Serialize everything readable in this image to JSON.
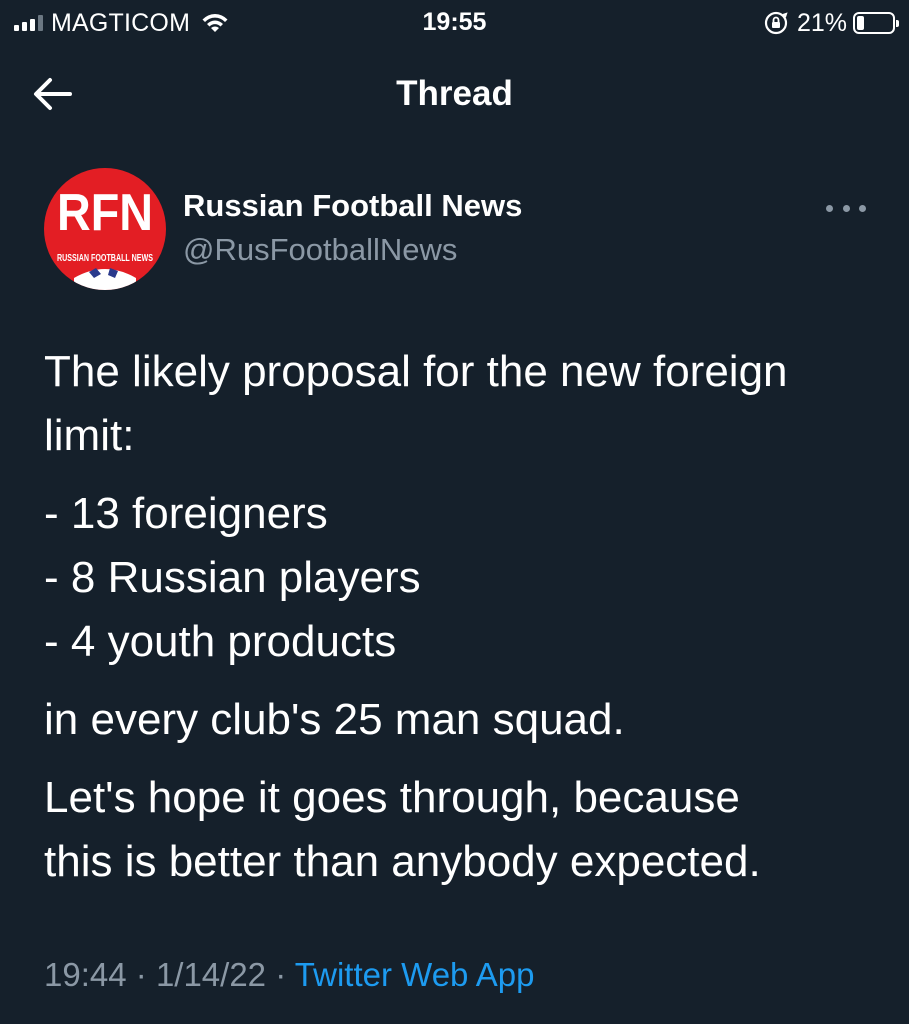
{
  "status_bar": {
    "carrier": "MAGTICOM",
    "time": "19:55",
    "battery_percent": "21%",
    "battery_level": 0.21,
    "signal_bars_active": 3,
    "signal_bars_total": 4
  },
  "nav": {
    "title": "Thread",
    "back_icon": "arrow-left-icon"
  },
  "tweet": {
    "author": {
      "name": "Russian Football News",
      "handle": "@RusFootballNews",
      "avatar_text": "RFN",
      "avatar_subtext": "RUSSIAN FOOTBALL NEWS"
    },
    "text": {
      "intro_line1": "The likely proposal for the new foreign",
      "intro_line2": "limit:",
      "item1": "- 13 foreigners",
      "item2": "- 8 Russian players",
      "item3": "- 4 youth products",
      "squad_line": "in every club's 25 man squad.",
      "closing_line1": "Let's hope it goes through, because",
      "closing_line2": "this is better than anybody expected."
    },
    "meta": {
      "time": "19:44",
      "separator": "·",
      "date": "1/14/22",
      "source": "Twitter Web App"
    }
  },
  "colors": {
    "background": "#15202b",
    "text": "#ffffff",
    "secondary_text": "#8b98a5",
    "link": "#1d9bf0",
    "avatar_red": "#e31e24"
  }
}
